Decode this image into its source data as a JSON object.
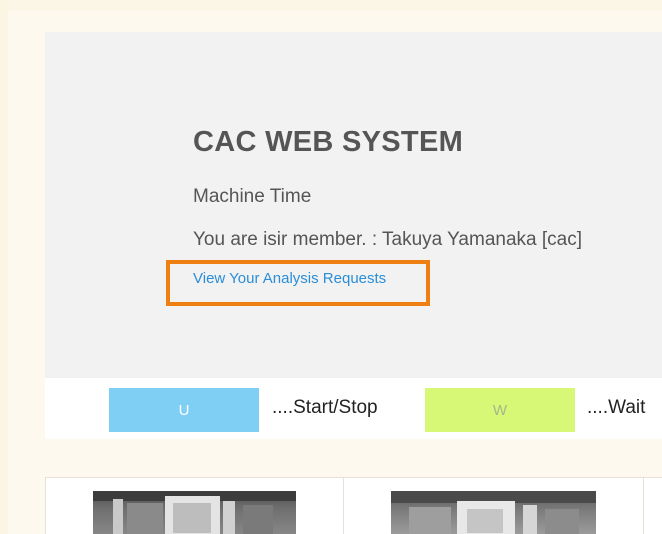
{
  "header": {
    "title": "CAC WEB SYSTEM",
    "subtitle": "Machine Time",
    "member_line": "You are isir member. : Takuya Yamanaka [cac]",
    "analysis_link": "View Your Analysis Requests"
  },
  "legend": {
    "items": [
      {
        "key": "U",
        "label": "....Start/Stop",
        "color": "#7fcff5"
      },
      {
        "key": "W",
        "label": "....Wait",
        "color": "#d7f777"
      }
    ]
  },
  "highlight_color": "#ee7f12",
  "link_color": "#2a8ed8"
}
